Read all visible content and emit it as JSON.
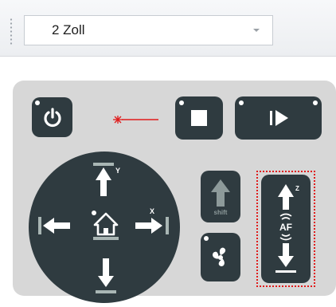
{
  "dropdown": {
    "value": "2 Zoll"
  },
  "panel": {
    "dpad": {
      "y_label": "Y",
      "x_label": "X"
    },
    "up_button": {
      "label": "shift"
    },
    "af_button": {
      "z_label": "Z",
      "af_label": "AF"
    }
  },
  "colors": {
    "button_bg": "#2f3b40",
    "panel_bg": "#d7d7d7",
    "laser_red": "#e01b1b",
    "af_frame": "#e01b1b"
  },
  "icons": [
    "power-icon",
    "laser-pointer-icon",
    "stop-icon",
    "play-icon",
    "arrow-up-icon",
    "arrow-down-icon",
    "arrow-left-icon",
    "arrow-right-icon",
    "home-icon",
    "shift-up-icon",
    "fan-icon",
    "autofocus-icon"
  ]
}
